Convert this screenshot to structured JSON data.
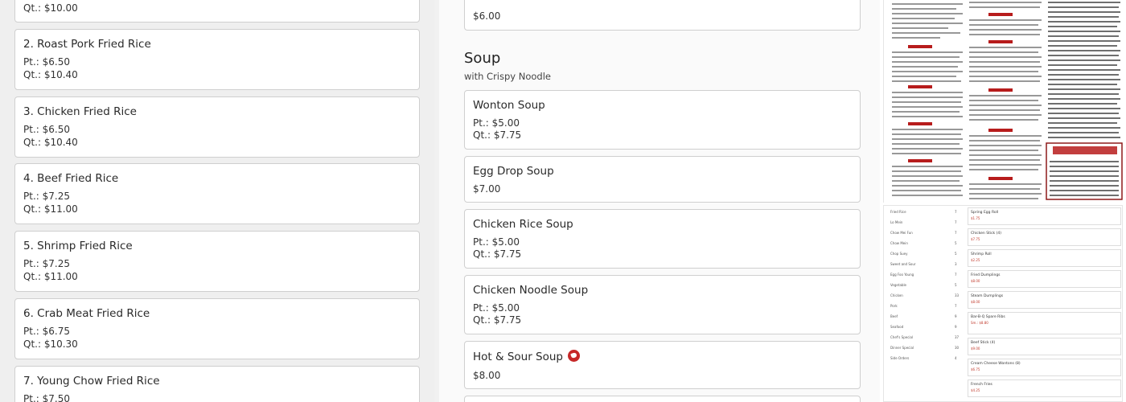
{
  "fried_rice": [
    {
      "title": "",
      "pt": "",
      "qt": "Qt.: $10.00"
    },
    {
      "title": "2. Roast Pork Fried Rice",
      "pt": "Pt.: $6.50",
      "qt": "Qt.: $10.40"
    },
    {
      "title": "3. Chicken Fried Rice",
      "pt": "Pt.: $6.50",
      "qt": "Qt.: $10.40"
    },
    {
      "title": "4. Beef Fried Rice",
      "pt": "Pt.: $7.25",
      "qt": "Qt.: $11.00"
    },
    {
      "title": "5. Shrimp Fried Rice",
      "pt": "Pt.: $7.25",
      "qt": "Qt.: $11.00"
    },
    {
      "title": "6. Crab Meat Fried Rice",
      "pt": "Pt.: $6.75",
      "qt": "Qt.: $10.30"
    },
    {
      "title": "7. Young Chow Fried Rice",
      "pt": "Pt.: $7.50",
      "qt": ""
    }
  ],
  "top_card": {
    "price": "$6.00"
  },
  "soup_section": {
    "title": "Soup",
    "subtitle": "with Crispy Noodle"
  },
  "soups": [
    {
      "title": "Wonton Soup",
      "pt": "Pt.: $5.00",
      "qt": "Qt.: $7.75"
    },
    {
      "title": "Egg Drop Soup",
      "price": "$7.00"
    },
    {
      "title": "Chicken Rice Soup",
      "pt": "Pt.: $5.00",
      "qt": "Qt.: $7.75"
    },
    {
      "title": "Chicken Noodle Soup",
      "pt": "Pt.: $5.00",
      "qt": "Qt.: $7.75"
    },
    {
      "title": "Hot & Sour Soup",
      "price": "$8.00",
      "icon": "spicy-icon"
    }
  ],
  "colors": {
    "card_border": "#cfcfcf",
    "spicy": "#c62828",
    "menu_red": "#b71c1c"
  },
  "menu_bottom": {
    "left_list": [
      {
        "name": "Fried Rice",
        "count": "7"
      },
      {
        "name": "Lo Mein",
        "count": "7"
      },
      {
        "name": "Chow Mei Fun",
        "count": "7"
      },
      {
        "name": "Chow Mein",
        "count": "5"
      },
      {
        "name": "Chop Suey",
        "count": "5"
      },
      {
        "name": "Sweet and Sour",
        "count": "3"
      },
      {
        "name": "Egg Foo Young",
        "count": "7"
      },
      {
        "name": "Vegetable",
        "count": "5"
      },
      {
        "name": "Chicken",
        "count": "33"
      },
      {
        "name": "Pork",
        "count": "7"
      },
      {
        "name": "Beef",
        "count": "9"
      },
      {
        "name": "Seafood",
        "count": "9"
      },
      {
        "name": "Chef's Special",
        "count": "37"
      },
      {
        "name": "Dinner Special",
        "count": "30"
      },
      {
        "name": "Side Orders",
        "count": "4"
      }
    ],
    "items": [
      {
        "name": "Spring Egg Roll",
        "price": "$1.75"
      },
      {
        "name": "Chicken Stick (4)",
        "price": "$7.75"
      },
      {
        "name": "Shrimp Roll",
        "price": "$2.25"
      },
      {
        "name": "Fried Dumplings",
        "price": "$8.00"
      },
      {
        "name": "Steam Dumplings",
        "price": "$8.00"
      },
      {
        "name": "Bar-B-Q Spare Ribs",
        "price": "Sm.: $8.80"
      },
      {
        "name": "Beef Stick (4)",
        "price": "$9.00"
      },
      {
        "name": "Cream Cheese Wontons (8)",
        "price": "$6.75"
      },
      {
        "name": "French Fries",
        "price": "$4.25"
      }
    ]
  }
}
